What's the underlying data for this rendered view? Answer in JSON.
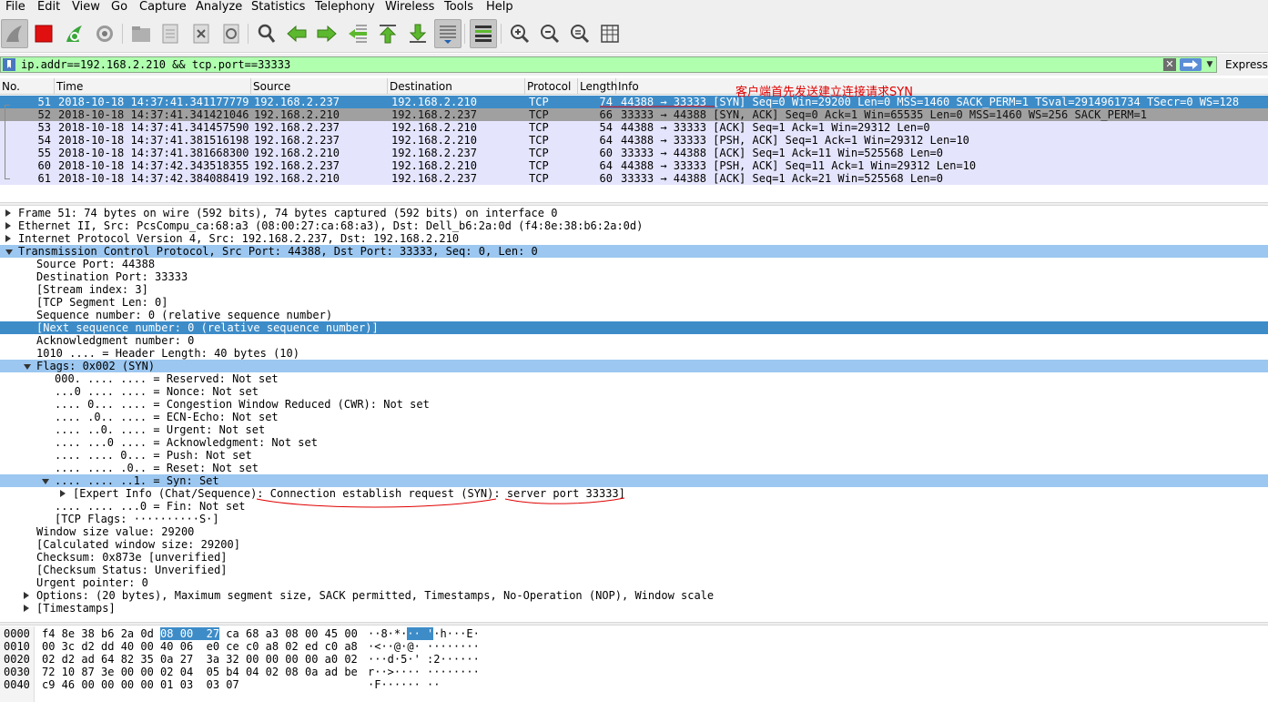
{
  "menu": [
    "File",
    "Edit",
    "View",
    "Go",
    "Capture",
    "Analyze",
    "Statistics",
    "Telephony",
    "Wireless",
    "Tools",
    "Help"
  ],
  "toolbar": {
    "buttons": [
      {
        "name": "shark-fin-start-icon"
      },
      {
        "name": "stop-capture-icon"
      },
      {
        "name": "restart-capture-icon"
      },
      {
        "name": "capture-options-icon"
      },
      {
        "name": "open-file-icon"
      },
      {
        "name": "save-file-icon"
      },
      {
        "name": "close-file-icon"
      },
      {
        "name": "reload-file-icon"
      },
      {
        "name": "find-packet-icon"
      },
      {
        "name": "go-back-icon"
      },
      {
        "name": "go-forward-icon"
      },
      {
        "name": "go-to-packet-icon"
      },
      {
        "name": "go-first-icon"
      },
      {
        "name": "go-last-icon"
      },
      {
        "name": "autoscroll-icon"
      },
      {
        "name": "colorize-icon"
      },
      {
        "name": "zoom-in-icon"
      },
      {
        "name": "zoom-out-icon"
      },
      {
        "name": "zoom-normal-icon"
      },
      {
        "name": "resize-columns-icon"
      }
    ]
  },
  "filter": {
    "value": "ip.addr==192.168.2.210 && tcp.port==33333",
    "expression_label": "Express"
  },
  "colors": {
    "filter_valid": "#afffaf",
    "selected_row": "#3d8cc8",
    "tcp_row": "#e4e4fc",
    "annotation": "#e00000"
  },
  "packet_list": {
    "columns": [
      "No.",
      "Time",
      "Source",
      "Destination",
      "Protocol",
      "Length",
      "Info"
    ],
    "rows": [
      {
        "no": "51",
        "time": "2018-10-18 14:37:41.341177779",
        "src": "192.168.2.237",
        "dst": "192.168.2.210",
        "proto": "TCP",
        "len": "74",
        "info": "44388 → 33333 [SYN] Seq=0 Win=29200 Len=0 MSS=1460 SACK_PERM=1 TSval=2914961734 TSecr=0 WS=128"
      },
      {
        "no": "52",
        "time": "2018-10-18 14:37:41.341421046",
        "src": "192.168.2.210",
        "dst": "192.168.2.237",
        "proto": "TCP",
        "len": "66",
        "info": "33333 → 44388 [SYN, ACK] Seq=0 Ack=1 Win=65535 Len=0 MSS=1460 WS=256 SACK_PERM=1"
      },
      {
        "no": "53",
        "time": "2018-10-18 14:37:41.341457590",
        "src": "192.168.2.237",
        "dst": "192.168.2.210",
        "proto": "TCP",
        "len": "54",
        "info": "44388 → 33333 [ACK] Seq=1 Ack=1 Win=29312 Len=0"
      },
      {
        "no": "54",
        "time": "2018-10-18 14:37:41.381516198",
        "src": "192.168.2.237",
        "dst": "192.168.2.210",
        "proto": "TCP",
        "len": "64",
        "info": "44388 → 33333 [PSH, ACK] Seq=1 Ack=1 Win=29312 Len=10"
      },
      {
        "no": "55",
        "time": "2018-10-18 14:37:41.381668300",
        "src": "192.168.2.210",
        "dst": "192.168.2.237",
        "proto": "TCP",
        "len": "60",
        "info": "33333 → 44388 [ACK] Seq=1 Ack=11 Win=525568 Len=0"
      },
      {
        "no": "60",
        "time": "2018-10-18 14:37:42.343518355",
        "src": "192.168.2.237",
        "dst": "192.168.2.210",
        "proto": "TCP",
        "len": "64",
        "info": "44388 → 33333 [PSH, ACK] Seq=11 Ack=1 Win=29312 Len=10"
      },
      {
        "no": "61",
        "time": "2018-10-18 14:37:42.384088419",
        "src": "192.168.2.210",
        "dst": "192.168.2.237",
        "proto": "TCP",
        "len": "60",
        "info": "33333 → 44388 [ACK] Seq=1 Ack=21 Win=525568 Len=0"
      }
    ]
  },
  "annotation": "客户端首先发送建立连接请求SYN",
  "details": [
    {
      "text": "Frame 51: 74 bytes on wire (592 bits), 74 bytes captured (592 bits) on interface 0",
      "level": 0,
      "tri": "closed"
    },
    {
      "text": "Ethernet II, Src: PcsCompu_ca:68:a3 (08:00:27:ca:68:a3), Dst: Dell_b6:2a:0d (f4:8e:38:b6:2a:0d)",
      "level": 0,
      "tri": "closed"
    },
    {
      "text": "Internet Protocol Version 4, Src: 192.168.2.237, Dst: 192.168.2.210",
      "level": 0,
      "tri": "closed"
    },
    {
      "text": "Transmission Control Protocol, Src Port: 44388, Dst Port: 33333, Seq: 0, Len: 0",
      "level": 0,
      "tri": "open",
      "sel": "light"
    },
    {
      "text": "Source Port: 44388",
      "level": 1
    },
    {
      "text": "Destination Port: 33333",
      "level": 1
    },
    {
      "text": "[Stream index: 3]",
      "level": 1
    },
    {
      "text": "[TCP Segment Len: 0]",
      "level": 1
    },
    {
      "text": "Sequence number: 0    (relative sequence number)",
      "level": 1
    },
    {
      "text": "[Next sequence number: 0    (relative sequence number)]",
      "level": 1,
      "sel": "strong"
    },
    {
      "text": "Acknowledgment number: 0",
      "level": 1
    },
    {
      "text": "1010 .... = Header Length: 40 bytes (10)",
      "level": 1
    },
    {
      "text": "Flags: 0x002 (SYN)",
      "level": 1,
      "tri": "open",
      "sel": "light"
    },
    {
      "text": "000. .... .... = Reserved: Not set",
      "level": 2
    },
    {
      "text": "...0 .... .... = Nonce: Not set",
      "level": 2
    },
    {
      "text": ".... 0... .... = Congestion Window Reduced (CWR): Not set",
      "level": 2
    },
    {
      "text": ".... .0.. .... = ECN-Echo: Not set",
      "level": 2
    },
    {
      "text": ".... ..0. .... = Urgent: Not set",
      "level": 2
    },
    {
      "text": ".... ...0 .... = Acknowledgment: Not set",
      "level": 2
    },
    {
      "text": ".... .... 0... = Push: Not set",
      "level": 2
    },
    {
      "text": ".... .... .0.. = Reset: Not set",
      "level": 2
    },
    {
      "text": ".... .... ..1. = Syn: Set",
      "level": 2,
      "tri": "open",
      "sel": "light"
    },
    {
      "text": "[Expert Info (Chat/Sequence): Connection establish request (SYN): server port 33333]",
      "level": 3,
      "tri": "closed"
    },
    {
      "text": ".... .... ...0 = Fin: Not set",
      "level": 2
    },
    {
      "text": "[TCP Flags: ··········S·]",
      "level": 2
    },
    {
      "text": "Window size value: 29200",
      "level": 1
    },
    {
      "text": "[Calculated window size: 29200]",
      "level": 1
    },
    {
      "text": "Checksum: 0x873e [unverified]",
      "level": 1
    },
    {
      "text": "[Checksum Status: Unverified]",
      "level": 1
    },
    {
      "text": "Urgent pointer: 0",
      "level": 1
    },
    {
      "text": "Options: (20 bytes), Maximum segment size, SACK permitted, Timestamps, No-Operation (NOP), Window scale",
      "level": 1,
      "tri": "closed"
    },
    {
      "text": "[Timestamps]",
      "level": 1,
      "tri": "closed"
    }
  ],
  "bytes": [
    {
      "offset": "0000",
      "hex_a": "f4 8e 38 b6 2a 0d ",
      "hex_hl": "08 00  27",
      "hex_b": " ca 68 a3 08 00 45 00",
      "asc_a": "··8·*·",
      "asc_hl": "·· '",
      "asc_b": "·h···E·"
    },
    {
      "offset": "0010",
      "hex_a": "00 3c d2 dd 40 00 40 06  e0 ce c0 a8 02 ed c0 a8",
      "asc_a": "·<··@·@· ········"
    },
    {
      "offset": "0020",
      "hex_a": "02 d2 ad 64 82 35 0a 27  3a 32 00 00 00 00 a0 02",
      "asc_a": "···d·5·' :2······"
    },
    {
      "offset": "0030",
      "hex_a": "72 10 87 3e 00 00 02 04  05 b4 04 02 08 0a ad be",
      "asc_a": "r··>···· ········"
    },
    {
      "offset": "0040",
      "hex_a": "c9 46 00 00 00 00 01 03  03 07",
      "asc_a": "·F······ ··"
    }
  ]
}
